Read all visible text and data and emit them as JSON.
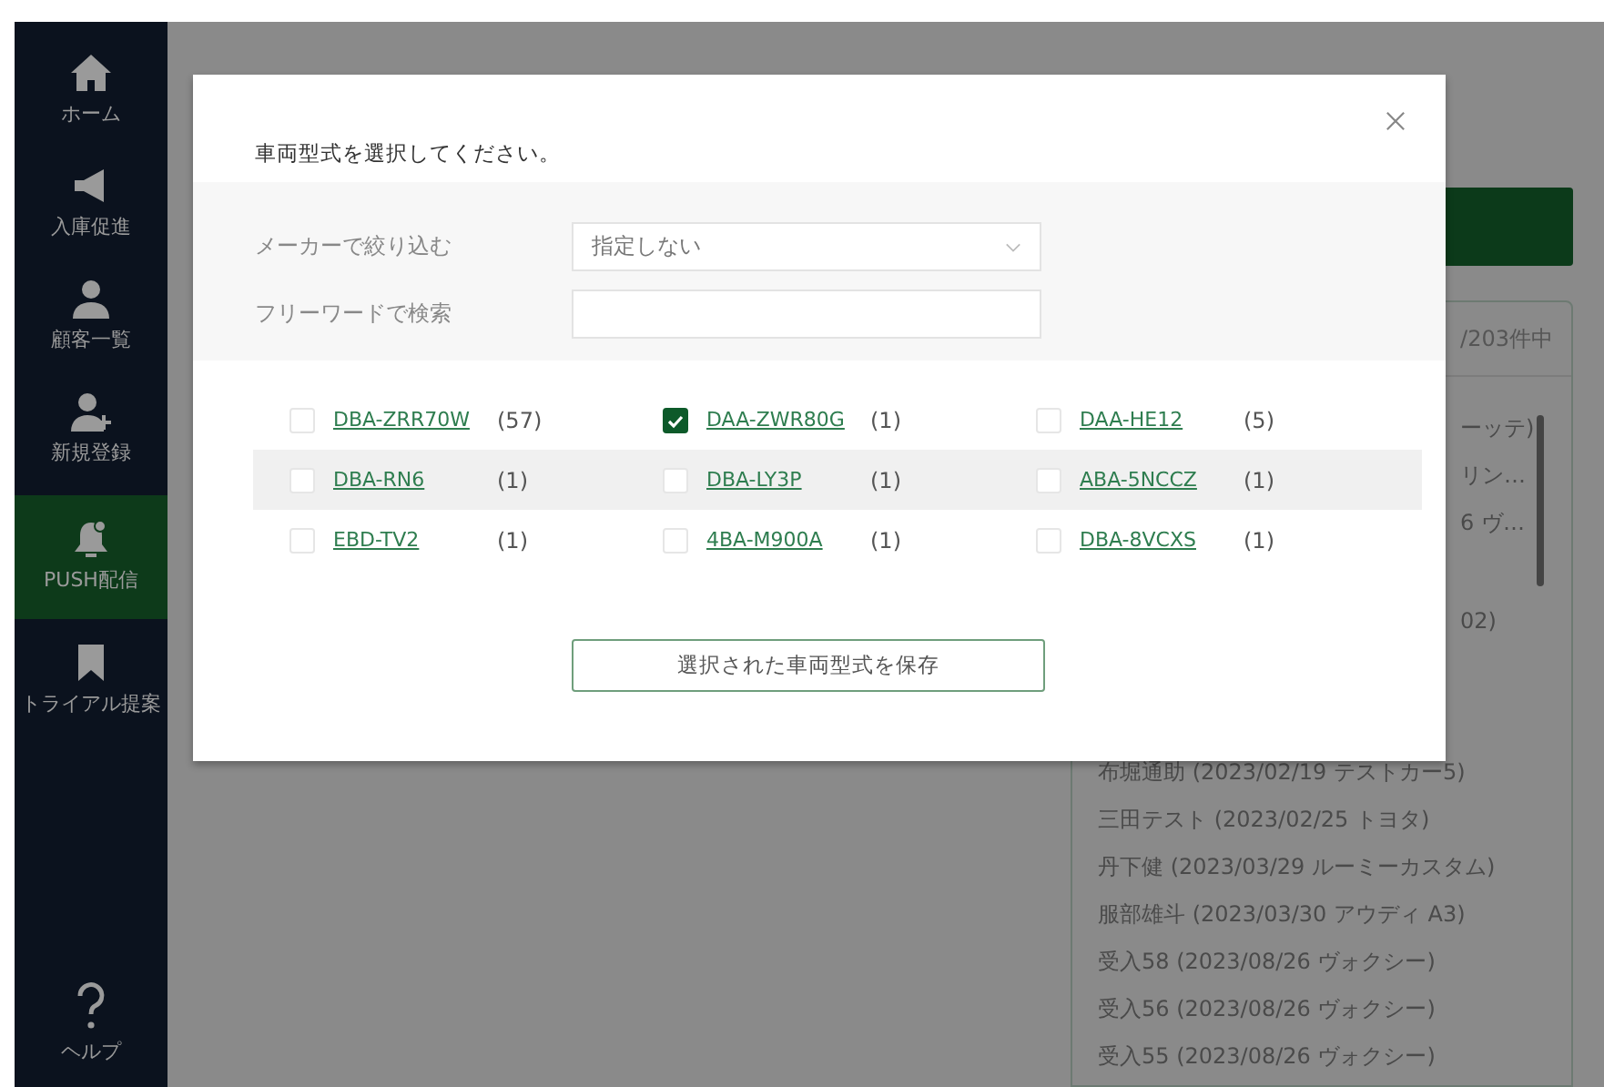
{
  "sidebar": {
    "items": [
      {
        "label": "ホーム",
        "selected": false
      },
      {
        "label": "入庫促進",
        "selected": false
      },
      {
        "label": "顧客一覧",
        "selected": false
      },
      {
        "label": "新規登録",
        "selected": false
      },
      {
        "label": "PUSH配信",
        "selected": true
      },
      {
        "label": "トライアル提案",
        "selected": false
      }
    ],
    "help": {
      "label": "ヘルプ",
      "selected": false
    }
  },
  "list_panel": {
    "count": "/203件中",
    "clipped_items": [
      "ーッテ)",
      "リン…",
      "6 ヴ…",
      "02)"
    ],
    "items": [
      "布堀通助 (2023/02/19 テストカー5)",
      "三田テスト (2023/02/25 トヨタ)",
      "丹下健 (2023/03/29 ルーミーカスタム)",
      "服部雄斗 (2023/03/30 アウディ A3)",
      "受入58 (2023/08/26 ヴォクシー)",
      "受入56 (2023/08/26 ヴォクシー)",
      "受入55 (2023/08/26 ヴォクシー)"
    ]
  },
  "modal": {
    "title": "車両型式を選択してください。",
    "filters": [
      {
        "label": "メーカーで絞り込む",
        "kind": "select",
        "value": "指定しない"
      },
      {
        "label": "フリーワードで検索",
        "kind": "text"
      }
    ],
    "options": [
      {
        "code": "DBA-ZRR70W",
        "count": "(57)",
        "checked": false
      },
      {
        "code": "DAA-ZWR80G",
        "count": "(1)",
        "checked": true
      },
      {
        "code": "DAA-HE12",
        "count": "(5)",
        "checked": false
      },
      {
        "code": "DBA-RN6",
        "count": "(1)",
        "checked": false
      },
      {
        "code": "DBA-LY3P",
        "count": "(1)",
        "checked": false
      },
      {
        "code": "ABA-5NCCZ",
        "count": "(1)",
        "checked": false
      },
      {
        "code": "EBD-TV2",
        "count": "(1)",
        "checked": false
      },
      {
        "code": "4BA-M900A",
        "count": "(1)",
        "checked": false
      },
      {
        "code": "DBA-8VCXS",
        "count": "(1)",
        "checked": false
      }
    ],
    "save_button": "選択された車両型式を保存"
  }
}
